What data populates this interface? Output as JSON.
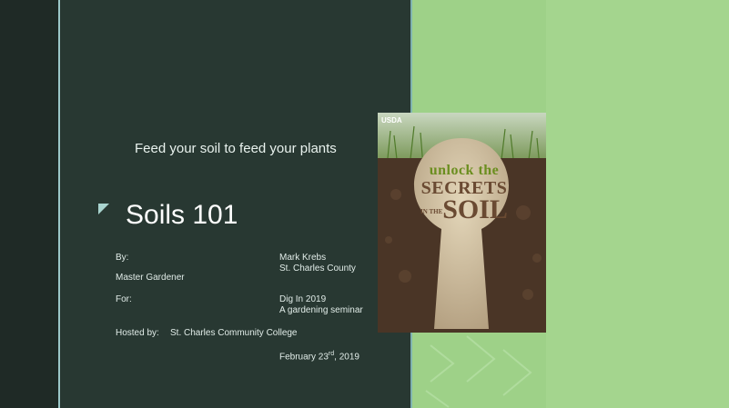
{
  "slide": {
    "subtitle": "Feed your soil to feed your plants",
    "title": "Soils 101",
    "by_label": "By:",
    "author_name": "Mark Krebs",
    "author_county": "St. Charles County",
    "author_role": "Master Gardener",
    "for_label": "For:",
    "event_name": "Dig  In 2019",
    "event_desc": "A gardening seminar",
    "hosted_label": "Hosted by:",
    "hosted_value": "St. Charles Community College",
    "date_prefix": "February 23",
    "date_suffix": "rd",
    "date_year": ", 2019"
  },
  "cover": {
    "agency": "USDA",
    "line1": "unlock the",
    "line2": "SECRETS",
    "line3_small": "IN THE",
    "line3": "SOIL"
  },
  "colors": {
    "panel": "#283832",
    "strip": "#1f2a26",
    "green": "#9fd68a",
    "accent": "#9bc7c8"
  }
}
